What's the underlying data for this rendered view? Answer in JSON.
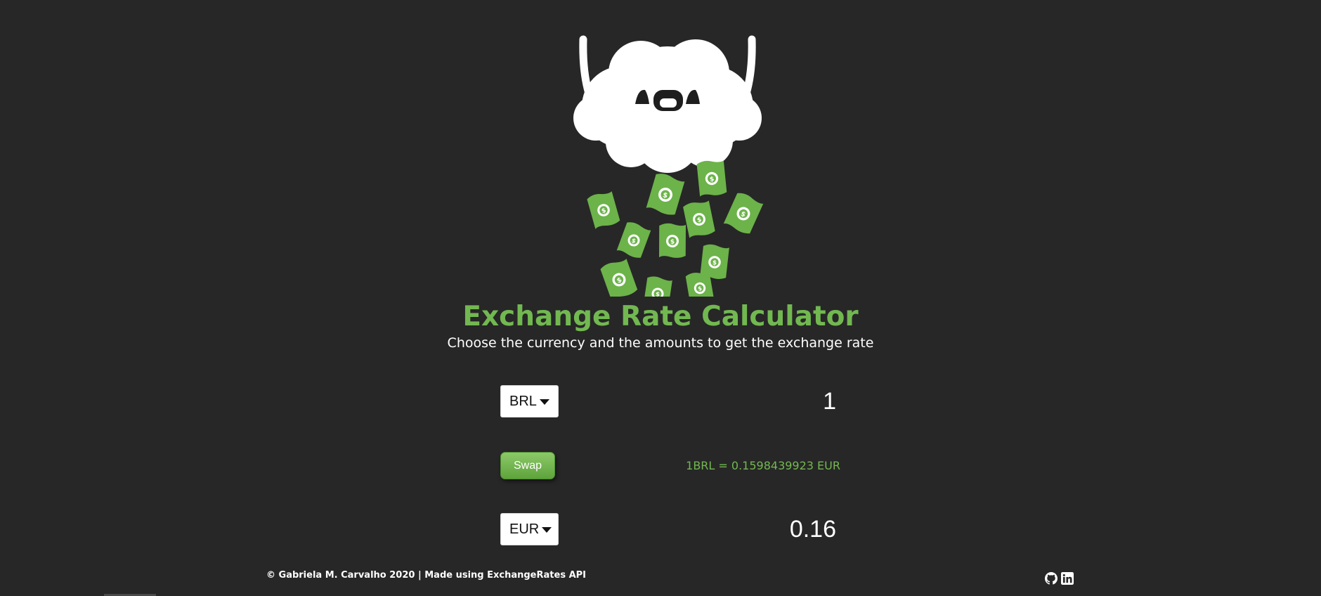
{
  "header": {
    "title": "Exchange Rate Calculator",
    "subtitle": "Choose the currency and the amounts to get the exchange rate"
  },
  "calculator": {
    "from_currency": "BRL",
    "from_amount": "1",
    "swap_label": "Swap",
    "rate_text": "1BRL = 0.1598439923 EUR",
    "to_currency": "EUR",
    "to_amount": "0.16"
  },
  "footer": {
    "credit": "© Gabriela M. Carvalho 2020 | Made using ExchangeRates API",
    "icons": [
      "github-icon",
      "linkedin-icon"
    ]
  },
  "colors": {
    "background": "#272727",
    "accent": "#72b851",
    "text": "#ffffff"
  }
}
